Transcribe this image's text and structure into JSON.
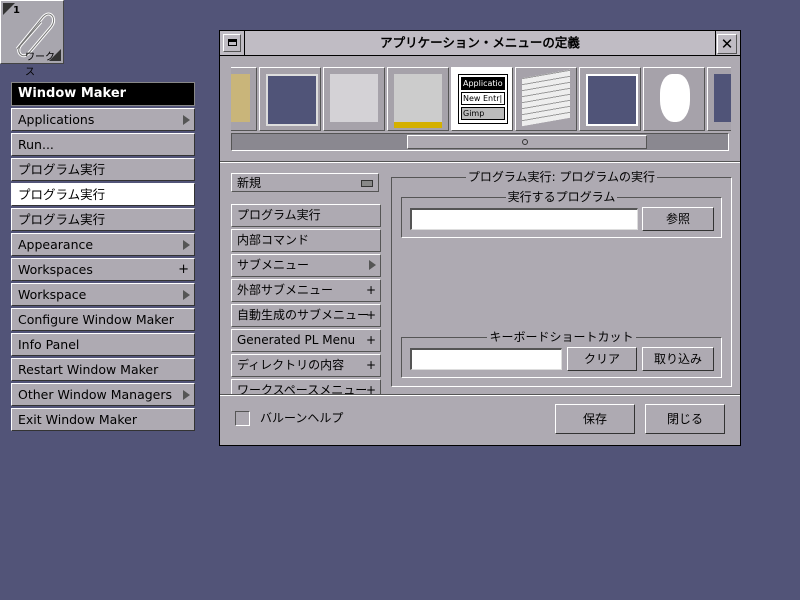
{
  "workspace_clip": {
    "number": "1",
    "name": "ワークス"
  },
  "root_menu": {
    "title": "Window Maker",
    "items": [
      {
        "label": "Applications",
        "indicator": "submenu"
      },
      {
        "label": "Run...",
        "indicator": ""
      },
      {
        "label": "プログラム実行",
        "indicator": ""
      },
      {
        "label": "プログラム実行",
        "indicator": "",
        "selected": true
      },
      {
        "label": "プログラム実行",
        "indicator": ""
      },
      {
        "label": "Appearance",
        "indicator": "submenu"
      },
      {
        "label": "Workspaces",
        "indicator": "+"
      },
      {
        "label": "Workspace",
        "indicator": "submenu"
      },
      {
        "label": "Configure Window Maker",
        "indicator": ""
      },
      {
        "label": "Info Panel",
        "indicator": ""
      },
      {
        "label": "Restart Window Maker",
        "indicator": ""
      },
      {
        "label": "Other Window Managers",
        "indicator": "submenu"
      },
      {
        "label": "Exit Window Maker",
        "indicator": ""
      }
    ]
  },
  "dialog": {
    "title": "アプリケーション・メニューの定義",
    "close_glyph": "✕",
    "toolbar_icons": [
      {
        "name": "folder-icon"
      },
      {
        "name": "window-focus-icon"
      },
      {
        "name": "window-handling-icon"
      },
      {
        "name": "icon-preferences-icon"
      },
      {
        "name": "applications-menu-icon",
        "selected": true,
        "lines": [
          "Applicatio",
          "New Entr|",
          "Gimp"
        ]
      },
      {
        "name": "keyboard-icon"
      },
      {
        "name": "workspace-icon"
      },
      {
        "name": "mouse-icon"
      },
      {
        "name": "appearance-icon"
      }
    ],
    "new_popup": "新規",
    "item_types": [
      {
        "label": "プログラム実行",
        "indicator": ""
      },
      {
        "label": "内部コマンド",
        "indicator": ""
      },
      {
        "label": "サブメニュー",
        "indicator": "submenu"
      },
      {
        "label": "外部サブメニュー",
        "indicator": "+"
      },
      {
        "label": "自動生成のサブメニュー",
        "indicator": "+"
      },
      {
        "label": "Generated PL Menu",
        "indicator": "+"
      },
      {
        "label": "ディレクトリの内容",
        "indicator": "+"
      },
      {
        "label": "ワークスペースメニュー",
        "indicator": "+"
      }
    ],
    "main_frame_title": "プログラム実行: プログラムの実行",
    "program_frame_title": "実行するプログラム",
    "program_value": "",
    "browse_button": "参照",
    "shortcut_frame_title": "キーボードショートカット",
    "shortcut_value": "",
    "clear_button": "クリア",
    "capture_button": "取り込み",
    "balloon_help_label": "バルーンヘルプ",
    "balloon_help_checked": false,
    "save_button": "保存",
    "close_button": "閉じる"
  }
}
